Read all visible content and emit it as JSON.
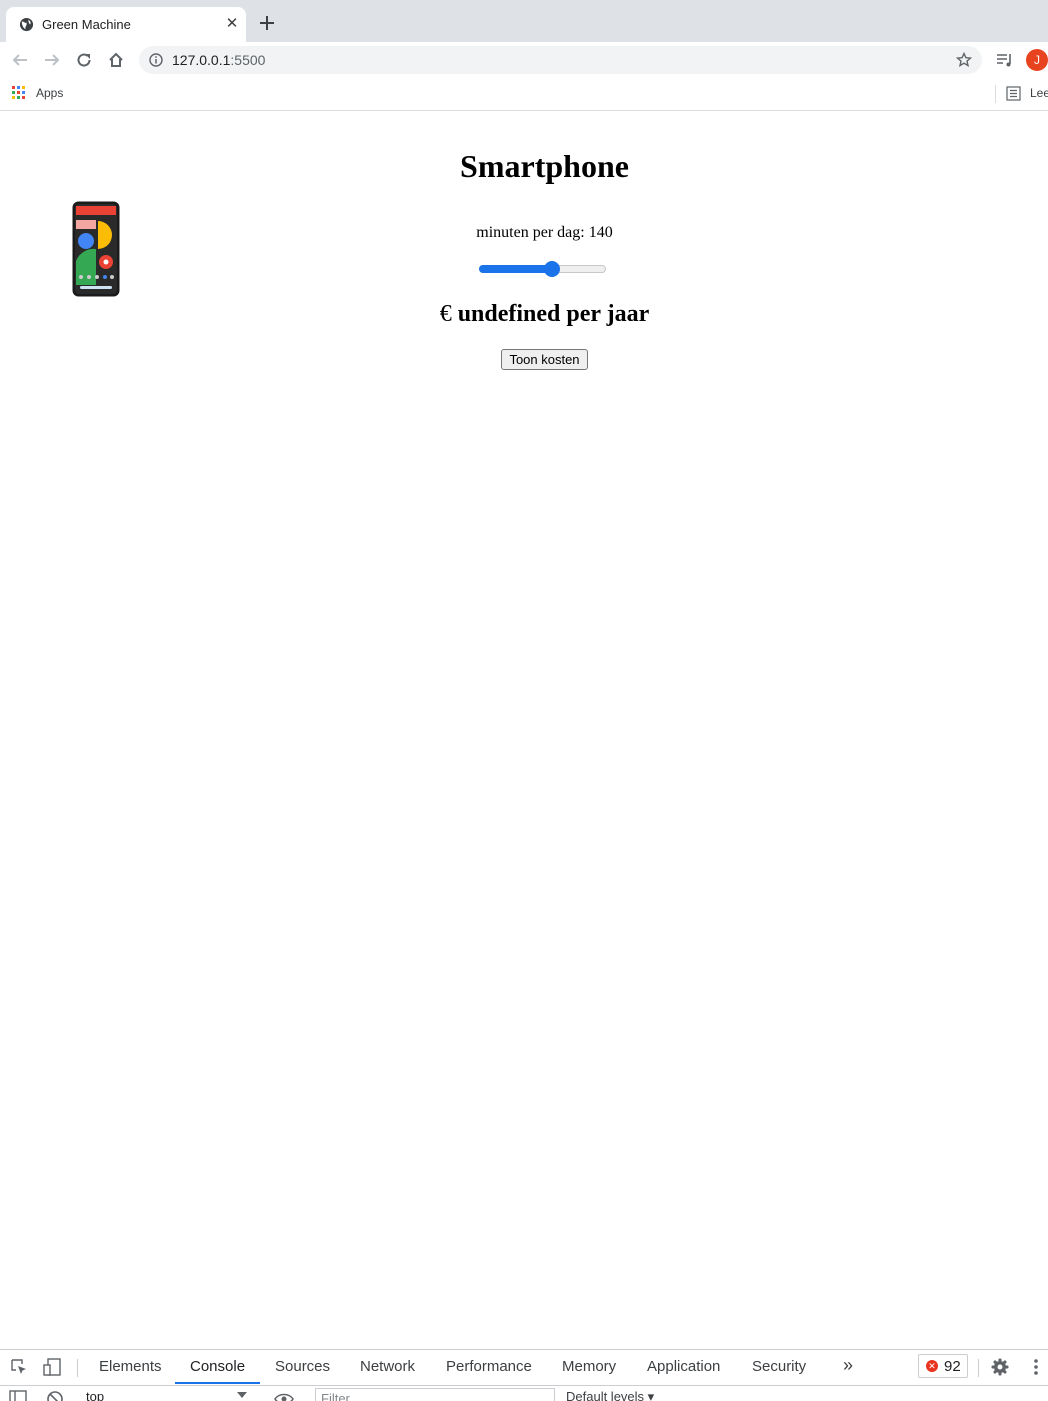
{
  "browser": {
    "tab_title": "Green Machine",
    "url_host": "127.0.0.1",
    "url_port": ":5500",
    "avatar_letter": "J",
    "bookmarks": {
      "apps_label": "Apps",
      "reading_list_label": "Lee"
    }
  },
  "page": {
    "heading": "Smartphone",
    "minutes_label": "minuten per dag: ",
    "minutes_value": "140",
    "slider": {
      "value": 140,
      "min": 0,
      "max": 240
    },
    "cost_prefix": "€",
    "cost_text": " undefined per jaar",
    "show_button": "Toon kosten"
  },
  "devtools": {
    "tabs": [
      "Elements",
      "Console",
      "Sources",
      "Network",
      "Performance",
      "Memory",
      "Application",
      "Security"
    ],
    "active_tab": "Console",
    "more": "»",
    "error_count": "92",
    "context": "top",
    "filter_placeholder": "Filter",
    "levels": "Default levels ▾"
  },
  "colors": {
    "accent": "#1a73e8",
    "avatar": "#e8431f",
    "error": "#e8331f"
  }
}
